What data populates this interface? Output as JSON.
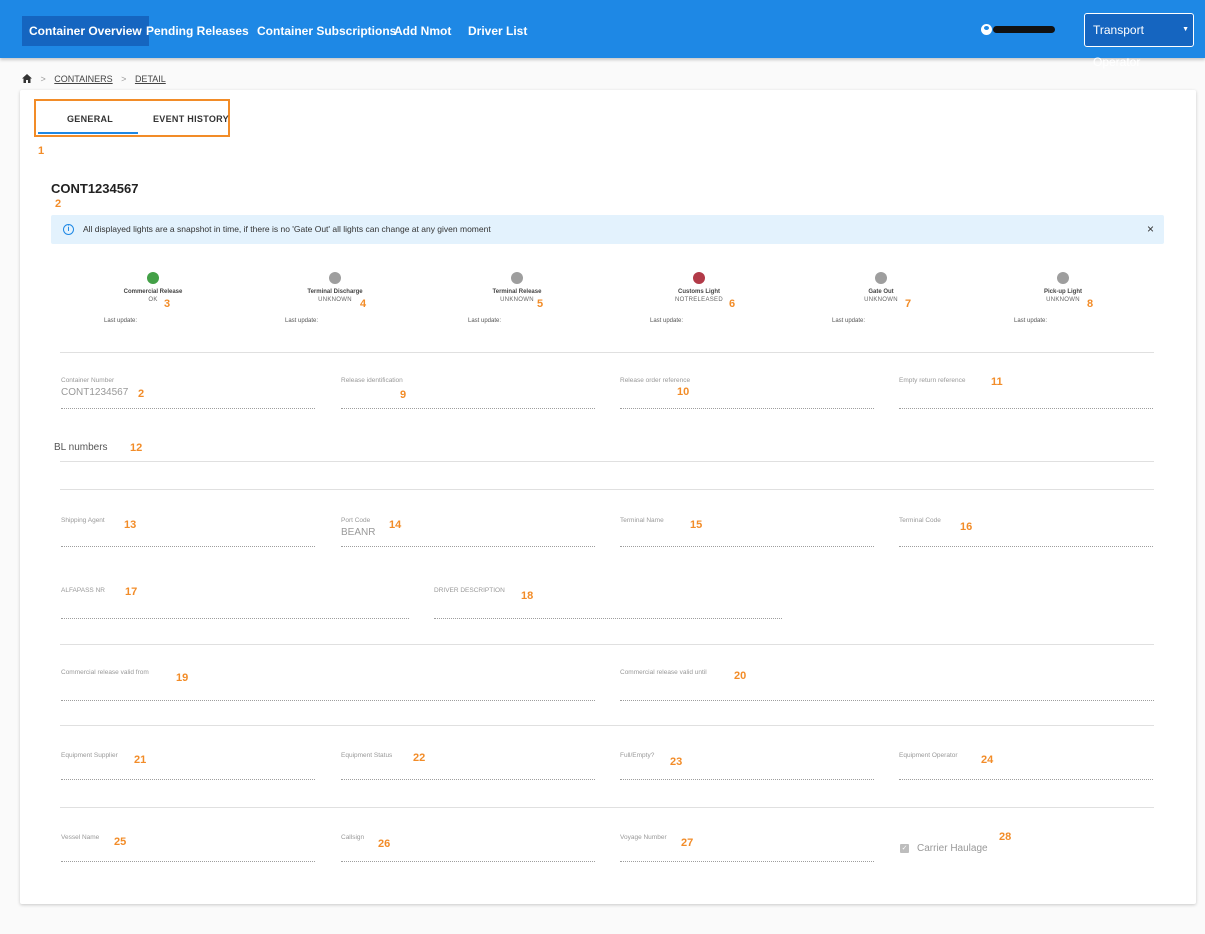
{
  "nav": {
    "items": [
      {
        "label": "Container Overview",
        "active": true
      },
      {
        "label": "Pending Releases",
        "active": false
      },
      {
        "label": "Container Subscriptions",
        "active": false
      },
      {
        "label": "Add Nmot",
        "active": false
      },
      {
        "label": "Driver List",
        "active": false
      }
    ],
    "role_label": "Transport Operator",
    "user_icon": "account-circle-icon"
  },
  "breadcrumb": {
    "home_icon": "home-icon",
    "separator": ">",
    "items": [
      "CONTAINERS",
      "DETAIL"
    ]
  },
  "tabs": [
    {
      "label": "GENERAL",
      "active": true
    },
    {
      "label": "EVENT HISTORY",
      "active": false
    }
  ],
  "container_title": "CONT1234567",
  "info": {
    "icon": "info-icon",
    "text": "All displayed lights are a snapshot in time, if there is no 'Gate Out' all lights can change at any given moment",
    "close": "×"
  },
  "lights": [
    {
      "name": "Commercial Release",
      "status": "OK",
      "color": "#43a047",
      "last_update": "Last update:",
      "marker": "3"
    },
    {
      "name": "Terminal Discharge",
      "status": "UNKNOWN",
      "color": "#9e9e9e",
      "last_update": "Last update:",
      "marker": "4"
    },
    {
      "name": "Terminal Release",
      "status": "UNKNOWN",
      "color": "#9e9e9e",
      "last_update": "Last update:",
      "marker": "5"
    },
    {
      "name": "Customs Light",
      "status": "NOTRELEASED",
      "color": "#b23a48",
      "last_update": "Last update:",
      "marker": "6"
    },
    {
      "name": "Gate Out",
      "status": "UNKNOWN",
      "color": "#9e9e9e",
      "last_update": "Last update:",
      "marker": "7"
    },
    {
      "name": "Pick-up Light",
      "status": "UNKNOWN",
      "color": "#9e9e9e",
      "last_update": "Last update:",
      "marker": "8"
    }
  ],
  "fields": {
    "container_number": {
      "label": "Container Number",
      "value": "CONT1234567"
    },
    "release_identification": {
      "label": "Release identification",
      "value": ""
    },
    "release_order_reference": {
      "label": "Release order reference",
      "value": ""
    },
    "empty_return_reference": {
      "label": "Empty return reference",
      "value": ""
    },
    "bl_numbers": {
      "label": "BL numbers"
    },
    "shipping_agent": {
      "label": "Shipping Agent",
      "value": ""
    },
    "port_code": {
      "label": "Port Code",
      "value": "BEANR"
    },
    "terminal_name": {
      "label": "Terminal Name",
      "value": ""
    },
    "terminal_code": {
      "label": "Terminal Code",
      "value": ""
    },
    "alfapass_nr": {
      "label": "ALFAPASS NR",
      "value": ""
    },
    "driver_description": {
      "label": "DRIVER DESCRIPTION",
      "value": ""
    },
    "commercial_release_valid_from": {
      "label": "Commercial release valid from",
      "value": ""
    },
    "commercial_release_valid_until": {
      "label": "Commercial release valid until",
      "value": ""
    },
    "equipment_supplier": {
      "label": "Equipment Supplier",
      "value": ""
    },
    "equipment_status": {
      "label": "Equipment Status",
      "value": ""
    },
    "full_empty": {
      "label": "Full/Empty?",
      "value": ""
    },
    "equipment_operator": {
      "label": "Equipment Operator",
      "value": ""
    },
    "vessel_name": {
      "label": "Vessel Name",
      "value": ""
    },
    "callsign": {
      "label": "Callsign",
      "value": ""
    },
    "voyage_number": {
      "label": "Voyage Number",
      "value": ""
    },
    "carrier_haulage": {
      "label": "Carrier Haulage",
      "checked": true
    }
  },
  "markers": {
    "m1": "1",
    "m2a": "2",
    "m2b": "2",
    "m9": "9",
    "m10": "10",
    "m11": "11",
    "m12": "12",
    "m13": "13",
    "m14": "14",
    "m15": "15",
    "m16": "16",
    "m17": "17",
    "m18": "18",
    "m19": "19",
    "m20": "20",
    "m21": "21",
    "m22": "22",
    "m23": "23",
    "m24": "24",
    "m25": "25",
    "m26": "26",
    "m27": "27",
    "m28": "28"
  },
  "colors": {
    "primary": "#1e88e5",
    "primary_dark": "#1565c0",
    "annotation": "#f28c28"
  }
}
